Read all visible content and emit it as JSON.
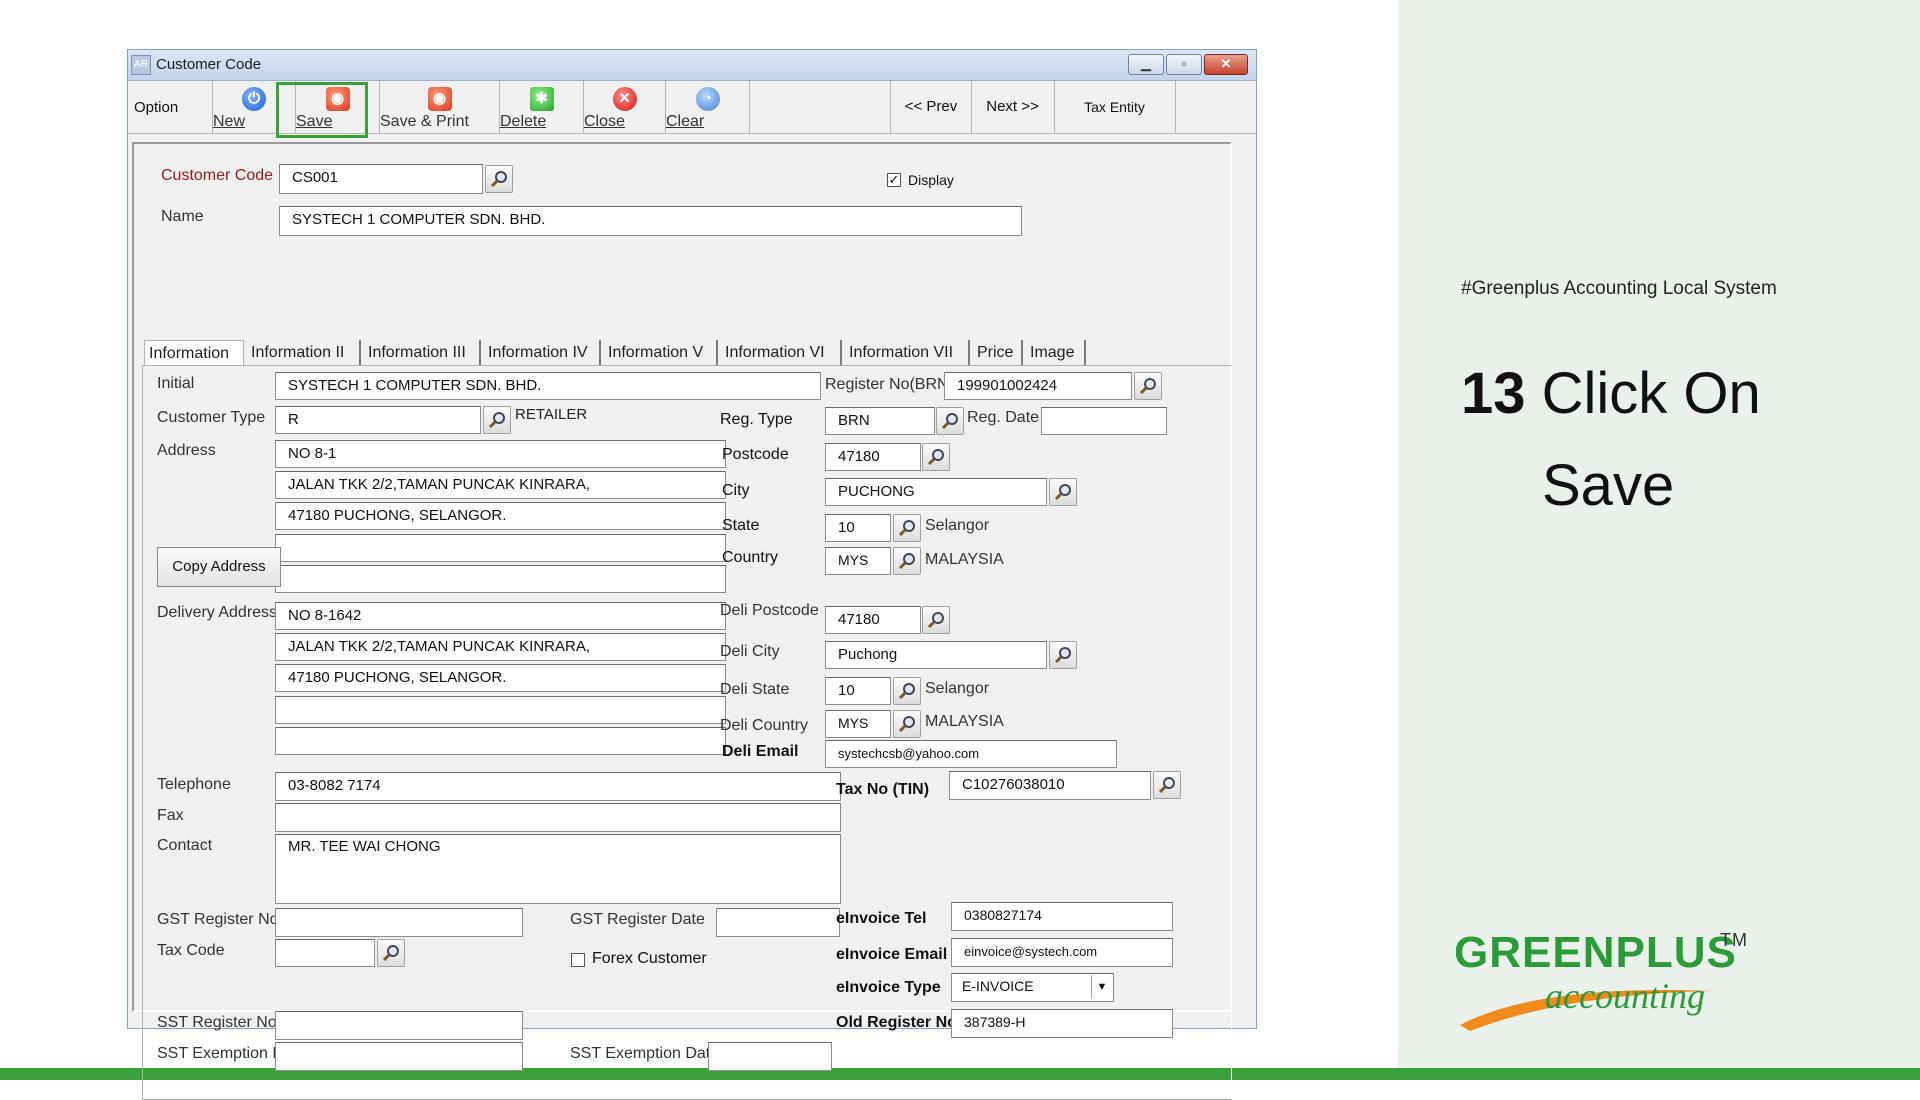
{
  "window": {
    "title": "Customer Code",
    "icon_text": "AR"
  },
  "toolbar": {
    "option_label": "Option",
    "new_label": "New",
    "save_label": "Save",
    "save_print_label": "Save & Print",
    "delete_label": "Delete",
    "close_label": "Close",
    "clear_label": "Clear",
    "prev_label": "<<  Prev",
    "next_label": "Next  >>",
    "tax_entity_label": "Tax Entity"
  },
  "header": {
    "customer_code_label": "Customer Code",
    "customer_code_value": "CS001",
    "display_label": "Display",
    "display_checked": "✓",
    "name_label": "Name",
    "name_value": "SYSTECH 1 COMPUTER SDN. BHD."
  },
  "tabs": [
    "Information",
    "Information II",
    "Information III",
    "Information IV",
    "Information V",
    "Information VI",
    "Information VII",
    "Price",
    "Image"
  ],
  "info": {
    "initial_label": "Initial",
    "initial_value": "SYSTECH 1 COMPUTER SDN. BHD.",
    "register_no_label": "Register No(BRN)",
    "register_no_value": "199901002424",
    "customer_type_label": "Customer Type",
    "customer_type_value": "R",
    "customer_type_desc": "RETAILER",
    "reg_type_label": "Reg. Type",
    "reg_type_value": "BRN",
    "reg_date_label": "Reg. Date",
    "address_label": "Address",
    "address_lines": [
      "NO 8-1",
      "JALAN TKK 2/2,TAMAN PUNCAK KINRARA,",
      "47180 PUCHONG, SELANGOR.",
      "",
      ""
    ],
    "postcode_label": "Postcode",
    "postcode_value": "47180",
    "city_label": "City",
    "city_value": "PUCHONG",
    "state_label": "State",
    "state_value": "10",
    "state_name": "Selangor",
    "country_label": "Country",
    "country_value": "MYS",
    "country_name": "MALAYSIA",
    "copy_address_label": "Copy Address",
    "delivery_address_label": "Delivery Address",
    "delivery_lines": [
      "NO 8-1642",
      "JALAN TKK 2/2,TAMAN PUNCAK KINRARA,",
      "47180 PUCHONG, SELANGOR.",
      "",
      ""
    ],
    "deli_postcode_label": "Deli Postcode",
    "deli_postcode_value": "47180",
    "deli_city_label": "Deli City",
    "deli_city_value": "Puchong",
    "deli_state_label": "Deli State",
    "deli_state_value": "10",
    "deli_state_name": "Selangor",
    "deli_country_label": "Deli Country",
    "deli_country_value": "MYS",
    "deli_country_name": "MALAYSIA",
    "deli_email_label": "Deli Email",
    "deli_email_value": "systechcsb@yahoo.com",
    "telephone_label": "Telephone",
    "telephone_value": "03-8082 7174",
    "tax_no_label": "Tax No (TIN)",
    "tax_no_value": "C10276038010",
    "fax_label": "Fax",
    "fax_value": "",
    "contact_label": "Contact",
    "contact_value": "MR. TEE WAI CHONG",
    "gst_reg_no_label": "GST Register No",
    "gst_reg_date_label": "GST Register Date",
    "einvoice_tel_label": "eInvoice Tel",
    "einvoice_tel_value": "0380827174",
    "tax_code_label": "Tax Code",
    "forex_label": "Forex Customer",
    "einvoice_email_label": "eInvoice Email",
    "einvoice_email_value": "einvoice@systech.com",
    "einvoice_type_label": "eInvoice Type",
    "einvoice_type_value": "E-INVOICE",
    "sst_reg_no_label": "SST Register No",
    "old_reg_no_label": "Old Register No",
    "old_reg_no_value": "387389-H",
    "sst_exemption_no_label": "SST Exemption No",
    "sst_exemption_date_label": "SST Exemption Date"
  },
  "side": {
    "hashtag": "#Greenplus Accounting Local System",
    "step_number": "13",
    "step_text_line1": "Click On",
    "step_text_line2": "Save",
    "brand_top": "GREENPLUS",
    "brand_tm": "TM",
    "brand_bottom": "accounting"
  },
  "colors": {
    "accent_green": "#3aa13a",
    "panel_bg": "#e9f1ea",
    "label_red": "#9b1c1c"
  }
}
